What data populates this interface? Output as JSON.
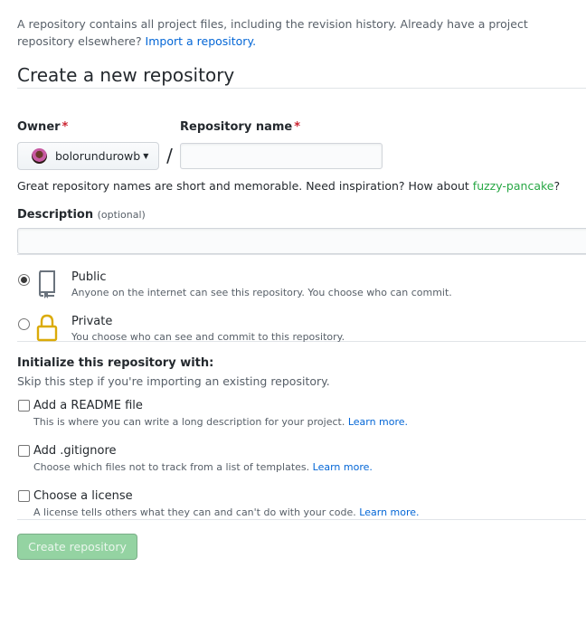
{
  "intro": {
    "text": "A repository contains all project files, including the revision history. Already have a project repository elsewhere? ",
    "import_link": "Import a repository."
  },
  "page_title": "Create a new repository",
  "owner": {
    "label": "Owner",
    "required_mark": "*",
    "value": "bolorundurowb"
  },
  "separator": "/",
  "repo_name": {
    "label": "Repository name",
    "required_mark": "*",
    "value": ""
  },
  "hint": {
    "prefix": "Great repository names are short and memorable. Need inspiration? How about ",
    "suggestion": "fuzzy-pancake",
    "suffix": "?"
  },
  "description": {
    "label": "Description",
    "optional": "(optional)",
    "value": ""
  },
  "visibility": {
    "selected": "public",
    "options": [
      {
        "title": "Public",
        "subtitle": "Anyone on the internet can see this repository. You choose who can commit."
      },
      {
        "title": "Private",
        "subtitle": "You choose who can see and commit to this repository."
      }
    ]
  },
  "init": {
    "title": "Initialize this repository with:",
    "subtitle": "Skip this step if you're importing an existing repository.",
    "options": [
      {
        "title": "Add a README file",
        "subtitle": "This is where you can write a long description for your project. ",
        "link": "Learn more."
      },
      {
        "title": "Add .gitignore",
        "subtitle": "Choose which files not to track from a list of templates. ",
        "link": "Learn more."
      },
      {
        "title": "Choose a license",
        "subtitle": "A license tells others what they can and can't do with your code. ",
        "link": "Learn more."
      }
    ]
  },
  "create_button": "Create repository",
  "colors": {
    "link": "#0366d6",
    "required": "#cb2431",
    "suggestion": "#28a745",
    "create_button_disabled": "#94d3a2"
  }
}
